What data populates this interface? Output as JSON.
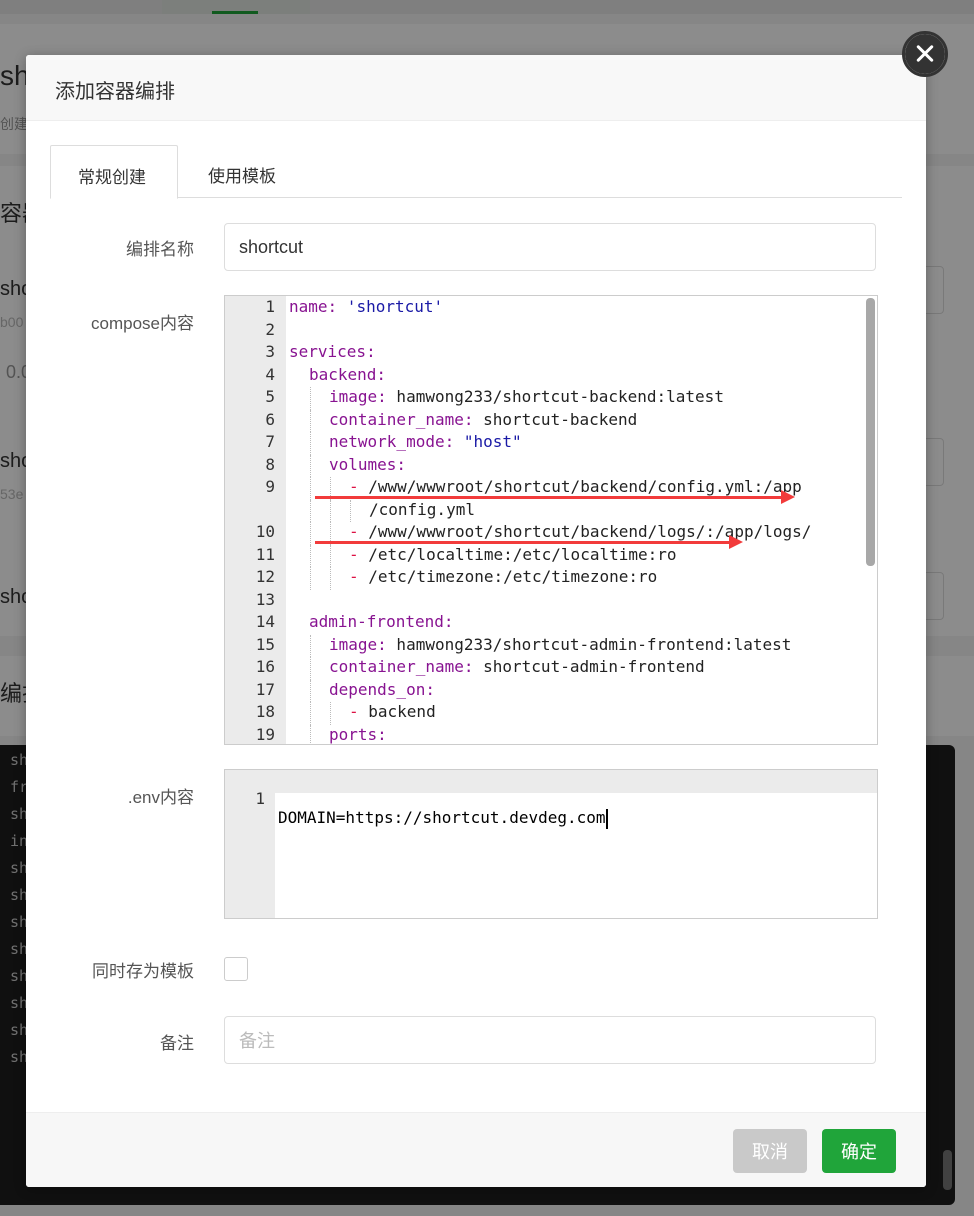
{
  "background": {
    "title_fragment": "sh",
    "sub_fragment": "创建",
    "section_fragment_1": "容器",
    "section_fragment_2": "编排",
    "row_fragments": [
      "sho",
      "sho",
      "sho"
    ],
    "id_fragments": [
      "b00",
      "53e"
    ],
    "value_fragment": "0.0",
    "terminal_lines": [
      "sh",
      "fr",
      "sh",
      "in",
      "sh",
      "sh",
      "sh",
      "sh",
      "sh",
      "sh",
      "sh",
      "sh"
    ]
  },
  "dialog": {
    "title": "添加容器编排",
    "tabs": [
      "常规创建",
      "使用模板"
    ],
    "name_label": "编排名称",
    "name_value": "shortcut",
    "compose_label": "compose内容",
    "compose_lines": [
      {
        "num": "1",
        "key": "name:",
        "val": " 'shortcut'",
        "val_type": "s",
        "indent": 0
      },
      {
        "num": "2",
        "key": "",
        "val": "",
        "val_type": "v",
        "indent": 0
      },
      {
        "num": "3",
        "key": "services:",
        "val": "",
        "val_type": "v",
        "indent": 0
      },
      {
        "num": "4",
        "key": "backend:",
        "val": "",
        "val_type": "v",
        "indent": 1
      },
      {
        "num": "5",
        "key": "image:",
        "val": " hamwong233/shortcut-backend:latest",
        "val_type": "v",
        "indent": 2
      },
      {
        "num": "6",
        "key": "container_name:",
        "val": " shortcut-backend",
        "val_type": "v",
        "indent": 2
      },
      {
        "num": "7",
        "key": "network_mode:",
        "val": " \"host\"",
        "val_type": "s",
        "indent": 2
      },
      {
        "num": "8",
        "key": "volumes:",
        "val": "",
        "val_type": "v",
        "indent": 2
      },
      {
        "num": "9",
        "key": "- ",
        "val": "/www/wwwroot/shortcut/backend/config.yml:/app",
        "val_type": "v",
        "indent": 3
      },
      {
        "num": "",
        "key": "",
        "val": "/config.yml",
        "val_type": "v",
        "indent": 4
      },
      {
        "num": "10",
        "key": "- ",
        "val": "/www/wwwroot/shortcut/backend/logs/:/app/logs/",
        "val_type": "v",
        "indent": 3
      },
      {
        "num": "11",
        "key": "- ",
        "val": "/etc/localtime:/etc/localtime:ro",
        "val_type": "v",
        "indent": 3
      },
      {
        "num": "12",
        "key": "- ",
        "val": "/etc/timezone:/etc/timezone:ro",
        "val_type": "v",
        "indent": 3
      },
      {
        "num": "13",
        "key": "",
        "val": "",
        "val_type": "v",
        "indent": 0
      },
      {
        "num": "14",
        "key": "admin-frontend:",
        "val": "",
        "val_type": "v",
        "indent": 1
      },
      {
        "num": "15",
        "key": "image:",
        "val": " hamwong233/shortcut-admin-frontend:latest",
        "val_type": "v",
        "indent": 2
      },
      {
        "num": "16",
        "key": "container_name:",
        "val": " shortcut-admin-frontend",
        "val_type": "v",
        "indent": 2
      },
      {
        "num": "17",
        "key": "depends_on:",
        "val": "",
        "val_type": "v",
        "indent": 2
      },
      {
        "num": "18",
        "key": "- ",
        "val": "backend",
        "val_type": "v",
        "indent": 3
      },
      {
        "num": "19",
        "key": "ports:",
        "val": "",
        "val_type": "v",
        "indent": 2
      }
    ],
    "env_label": ".env内容",
    "env_lines": [
      {
        "num": "1",
        "text": "DOMAIN=https://shortcut.devdeg.com"
      }
    ],
    "template_label": "同时存为模板",
    "remark_label": "备注",
    "remark_placeholder": "备注",
    "cancel_label": "取消",
    "ok_label": "确定"
  },
  "colors": {
    "accent": "#20a53a",
    "yaml_key": "#881391",
    "yaml_string": "#1a1aa6",
    "annotation_arrow": "#f23b3b"
  }
}
